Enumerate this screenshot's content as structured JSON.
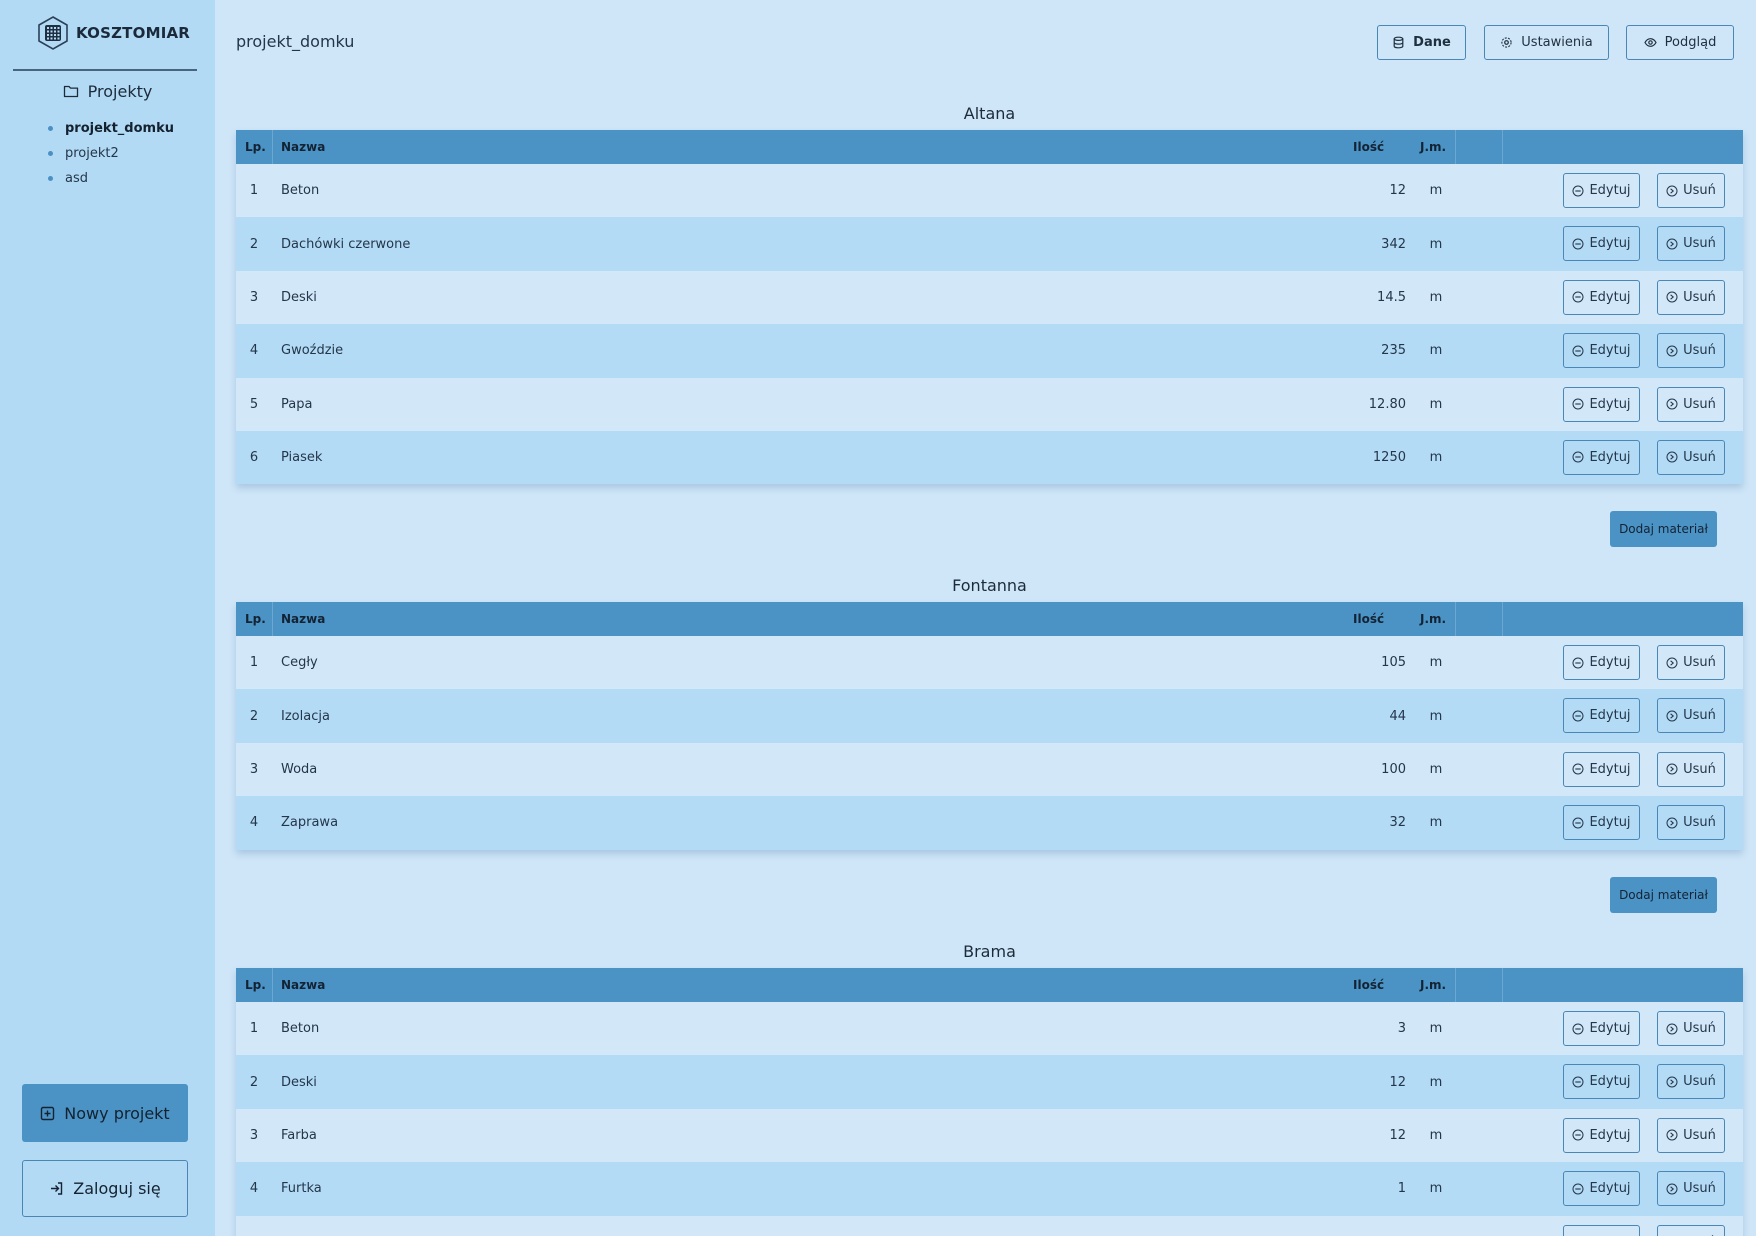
{
  "app": {
    "brand": "KOSZTOMIAR"
  },
  "sidebar": {
    "heading": "Projekty",
    "projects": [
      "projekt_domku",
      "projekt2",
      "asd"
    ],
    "active_project": "projekt_domku",
    "new_project_label": "Nowy projekt",
    "login_label": "Zaloguj się"
  },
  "header": {
    "title": "projekt_domku",
    "buttons": {
      "dane": "Dane",
      "ustawienia": "Ustawienia",
      "podglad": "Podgląd"
    }
  },
  "table_headers": {
    "lp": "Lp.",
    "nazwa": "Nazwa",
    "ilosc": "Ilość",
    "jm": "J.m."
  },
  "row_actions": {
    "edit": "Edytuj",
    "delete": "Usuń"
  },
  "add_material_label": "Dodaj materiał",
  "sections": [
    {
      "title": "Altana",
      "rows": [
        {
          "lp": "1",
          "name": "Beton",
          "qty": "12",
          "unit": "m"
        },
        {
          "lp": "2",
          "name": "Dachówki czerwone",
          "qty": "342",
          "unit": "m"
        },
        {
          "lp": "3",
          "name": "Deski",
          "qty": "14.5",
          "unit": "m"
        },
        {
          "lp": "4",
          "name": "Gwoździe",
          "qty": "235",
          "unit": "m"
        },
        {
          "lp": "5",
          "name": "Papa",
          "qty": "12.80",
          "unit": "m"
        },
        {
          "lp": "6",
          "name": "Piasek",
          "qty": "1250",
          "unit": "m"
        }
      ]
    },
    {
      "title": "Fontanna",
      "rows": [
        {
          "lp": "1",
          "name": "Cegły",
          "qty": "105",
          "unit": "m"
        },
        {
          "lp": "2",
          "name": "Izolacja",
          "qty": "44",
          "unit": "m"
        },
        {
          "lp": "3",
          "name": "Woda",
          "qty": "100",
          "unit": "m"
        },
        {
          "lp": "4",
          "name": "Zaprawa",
          "qty": "32",
          "unit": "m"
        }
      ]
    },
    {
      "title": "Brama",
      "rows": [
        {
          "lp": "1",
          "name": "Beton",
          "qty": "3",
          "unit": "m"
        },
        {
          "lp": "2",
          "name": "Deski",
          "qty": "12",
          "unit": "m"
        },
        {
          "lp": "3",
          "name": "Farba",
          "qty": "12",
          "unit": "m"
        },
        {
          "lp": "4",
          "name": "Furtka",
          "qty": "1",
          "unit": "m"
        },
        {
          "lp": "",
          "name": "",
          "qty": "",
          "unit": ""
        }
      ]
    }
  ]
}
